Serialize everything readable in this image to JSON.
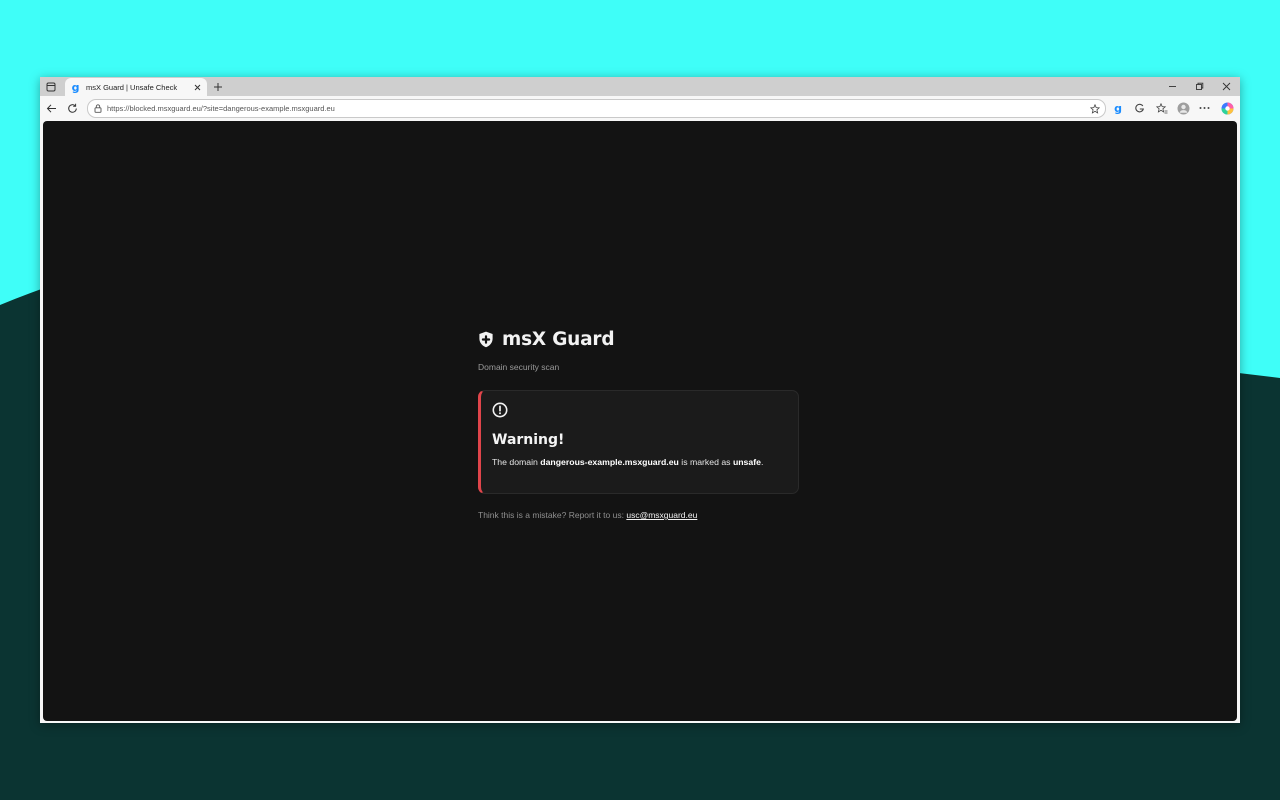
{
  "browser": {
    "tab": {
      "title": "msX Guard | Unsafe Check",
      "favicon": "msxguard-g-icon"
    },
    "address_bar": {
      "url": "https://blocked.msxguard.eu/?site=dangerous-example.msxguard.eu"
    },
    "extension_icon": "g"
  },
  "page": {
    "brand_name": "msX Guard",
    "subtitle": "Domain security scan",
    "warning": {
      "title": "Warning!",
      "message_prefix": "The domain ",
      "domain": "dangerous-example.msxguard.eu",
      "message_middle": " is marked as ",
      "status": "unsafe",
      "message_suffix": "."
    },
    "report": {
      "text": "Think this is a mistake? Report it to us: ",
      "email": "usc@msxguard.eu"
    }
  },
  "colors": {
    "desktop_top": "#3ffef8",
    "desktop_hill": "#0b3432",
    "page_background": "#131313",
    "card_background": "#1b1b1b",
    "warning_accent": "#e0454b"
  }
}
